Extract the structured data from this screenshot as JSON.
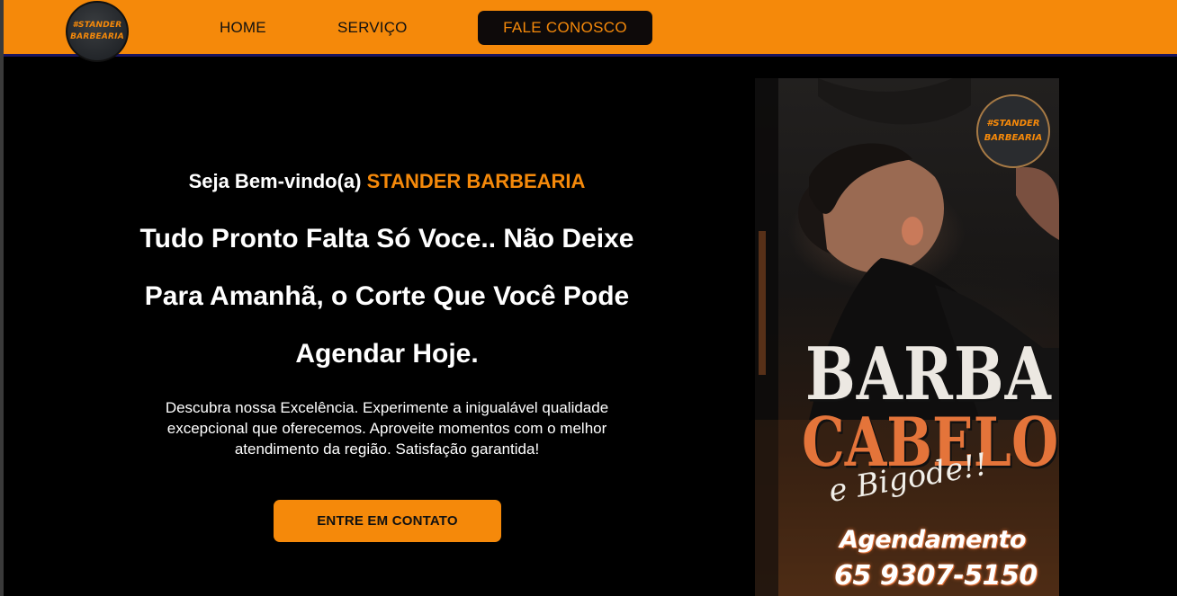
{
  "header": {
    "logo_line1": "#STANDER",
    "logo_line2": "BARBEARIA",
    "nav": {
      "home": "HOME",
      "servico": "SERVIÇO",
      "contact": "FALE CONOSCO"
    }
  },
  "hero": {
    "welcome_prefix": "Seja Bem-vindo(a) ",
    "welcome_brand": "STANDER BARBEARIA",
    "headline_line1": "Tudo Pronto Falta Só Voce.. Não Deixe",
    "headline_line2": "Para Amanhã, o Corte Que Você Pode",
    "headline_line3": "Agendar Hoje.",
    "description": "Descubra nossa Excelência. Experimente a inigualável qualidade excepcional que oferecemos. Aproveite momentos com o melhor atendimento da região. Satisfação garantida!",
    "cta_label": "ENTRE EM CONTATO"
  },
  "poster": {
    "badge_line1": "#STANDER",
    "badge_line2": "BARBEARIA",
    "title_line1": "BARBA",
    "title_line2": "CABELO",
    "script_text": "e Bigode!!",
    "booking_label": "Agendamento",
    "phone": "65 9307-5150"
  },
  "colors": {
    "accent": "#f5890a",
    "background": "#000000",
    "header_border": "#1a1560",
    "poster_orange": "#e4743a"
  }
}
